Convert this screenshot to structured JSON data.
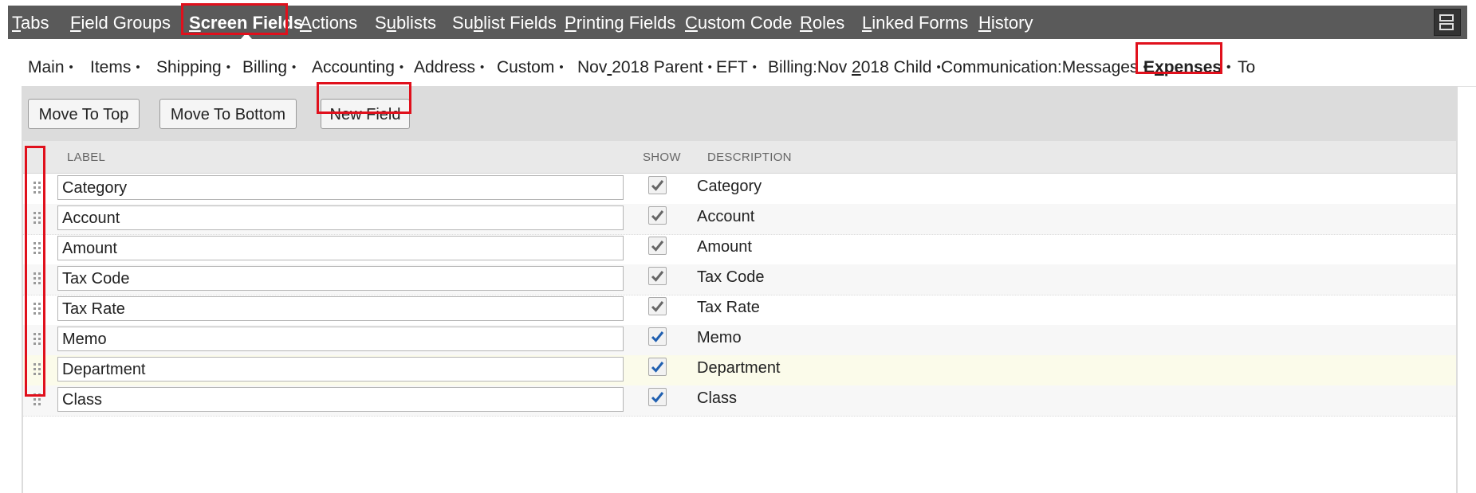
{
  "top_tabs": [
    {
      "pre": "",
      "ul": "T",
      "post": "abs"
    },
    {
      "pre": "",
      "ul": "F",
      "post": "ield Groups"
    },
    {
      "pre": "",
      "ul": "S",
      "post": "creen Fields"
    },
    {
      "pre": "",
      "ul": "A",
      "post": "ctions"
    },
    {
      "pre": "S",
      "ul": "u",
      "post": "blists"
    },
    {
      "pre": "Su",
      "ul": "b",
      "post": "list Fields"
    },
    {
      "pre": "",
      "ul": "P",
      "post": "rinting Fields"
    },
    {
      "pre": "",
      "ul": "C",
      "post": "ustom Code"
    },
    {
      "pre": "",
      "ul": "R",
      "post": "oles"
    },
    {
      "pre": "",
      "ul": "L",
      "post": "inked Forms"
    },
    {
      "pre": "",
      "ul": "H",
      "post": "istory"
    }
  ],
  "sub_tabs": [
    {
      "pre": "Main",
      "ul": "",
      "post": "",
      "dot": "•"
    },
    {
      "pre": "Items",
      "ul": "",
      "post": "",
      "dot": "•"
    },
    {
      "pre": "Shipping",
      "ul": "",
      "post": "",
      "dot": "•"
    },
    {
      "pre": "Billing",
      "ul": "",
      "post": "",
      "dot": "•"
    },
    {
      "pre": "Accounting",
      "ul": "",
      "post": "",
      "dot": "•"
    },
    {
      "pre": "Address",
      "ul": "",
      "post": "",
      "dot": "•"
    },
    {
      "pre": "Custom",
      "ul": "",
      "post": "",
      "dot": "•"
    },
    {
      "pre": "Nov",
      "ul": " ",
      "post": "2018 Parent",
      "dot": "•"
    },
    {
      "pre": "EFT",
      "ul": "",
      "post": "",
      "dot": "•"
    },
    {
      "pre": "Billing:Nov ",
      "ul": "2",
      "post": "018 Child",
      "dot": "•"
    },
    {
      "pre": "Communication:Messages",
      "ul": "",
      "post": "",
      "dot": "•"
    },
    {
      "pre": "E",
      "ul": "x",
      "post": "penses",
      "dot": "•"
    },
    {
      "pre": "To",
      "ul": "",
      "post": "",
      "dot": ""
    }
  ],
  "buttons": {
    "move_to_top": "Move To Top",
    "move_to_bottom": "Move To Bottom",
    "new_field": "New Field"
  },
  "grid_header": {
    "label": "LABEL",
    "show": "SHOW",
    "description": "DESCRIPTION"
  },
  "rows": [
    {
      "label": "Category",
      "show": true,
      "locked": true,
      "description": "Category"
    },
    {
      "label": "Account",
      "show": true,
      "locked": true,
      "description": "Account"
    },
    {
      "label": "Amount",
      "show": true,
      "locked": true,
      "description": "Amount"
    },
    {
      "label": "Tax Code",
      "show": true,
      "locked": true,
      "description": "Tax Code"
    },
    {
      "label": "Tax Rate",
      "show": true,
      "locked": true,
      "description": "Tax Rate"
    },
    {
      "label": "Memo",
      "show": true,
      "locked": false,
      "description": "Memo"
    },
    {
      "label": "Department",
      "show": true,
      "locked": false,
      "description": "Department"
    },
    {
      "label": "Class",
      "show": true,
      "locked": false,
      "description": "Class"
    }
  ],
  "colors": {
    "topbar": "#5a5a5a",
    "annotation_red": "#e0101c",
    "check_locked": "#666666",
    "check_active": "#1f5fb0"
  }
}
